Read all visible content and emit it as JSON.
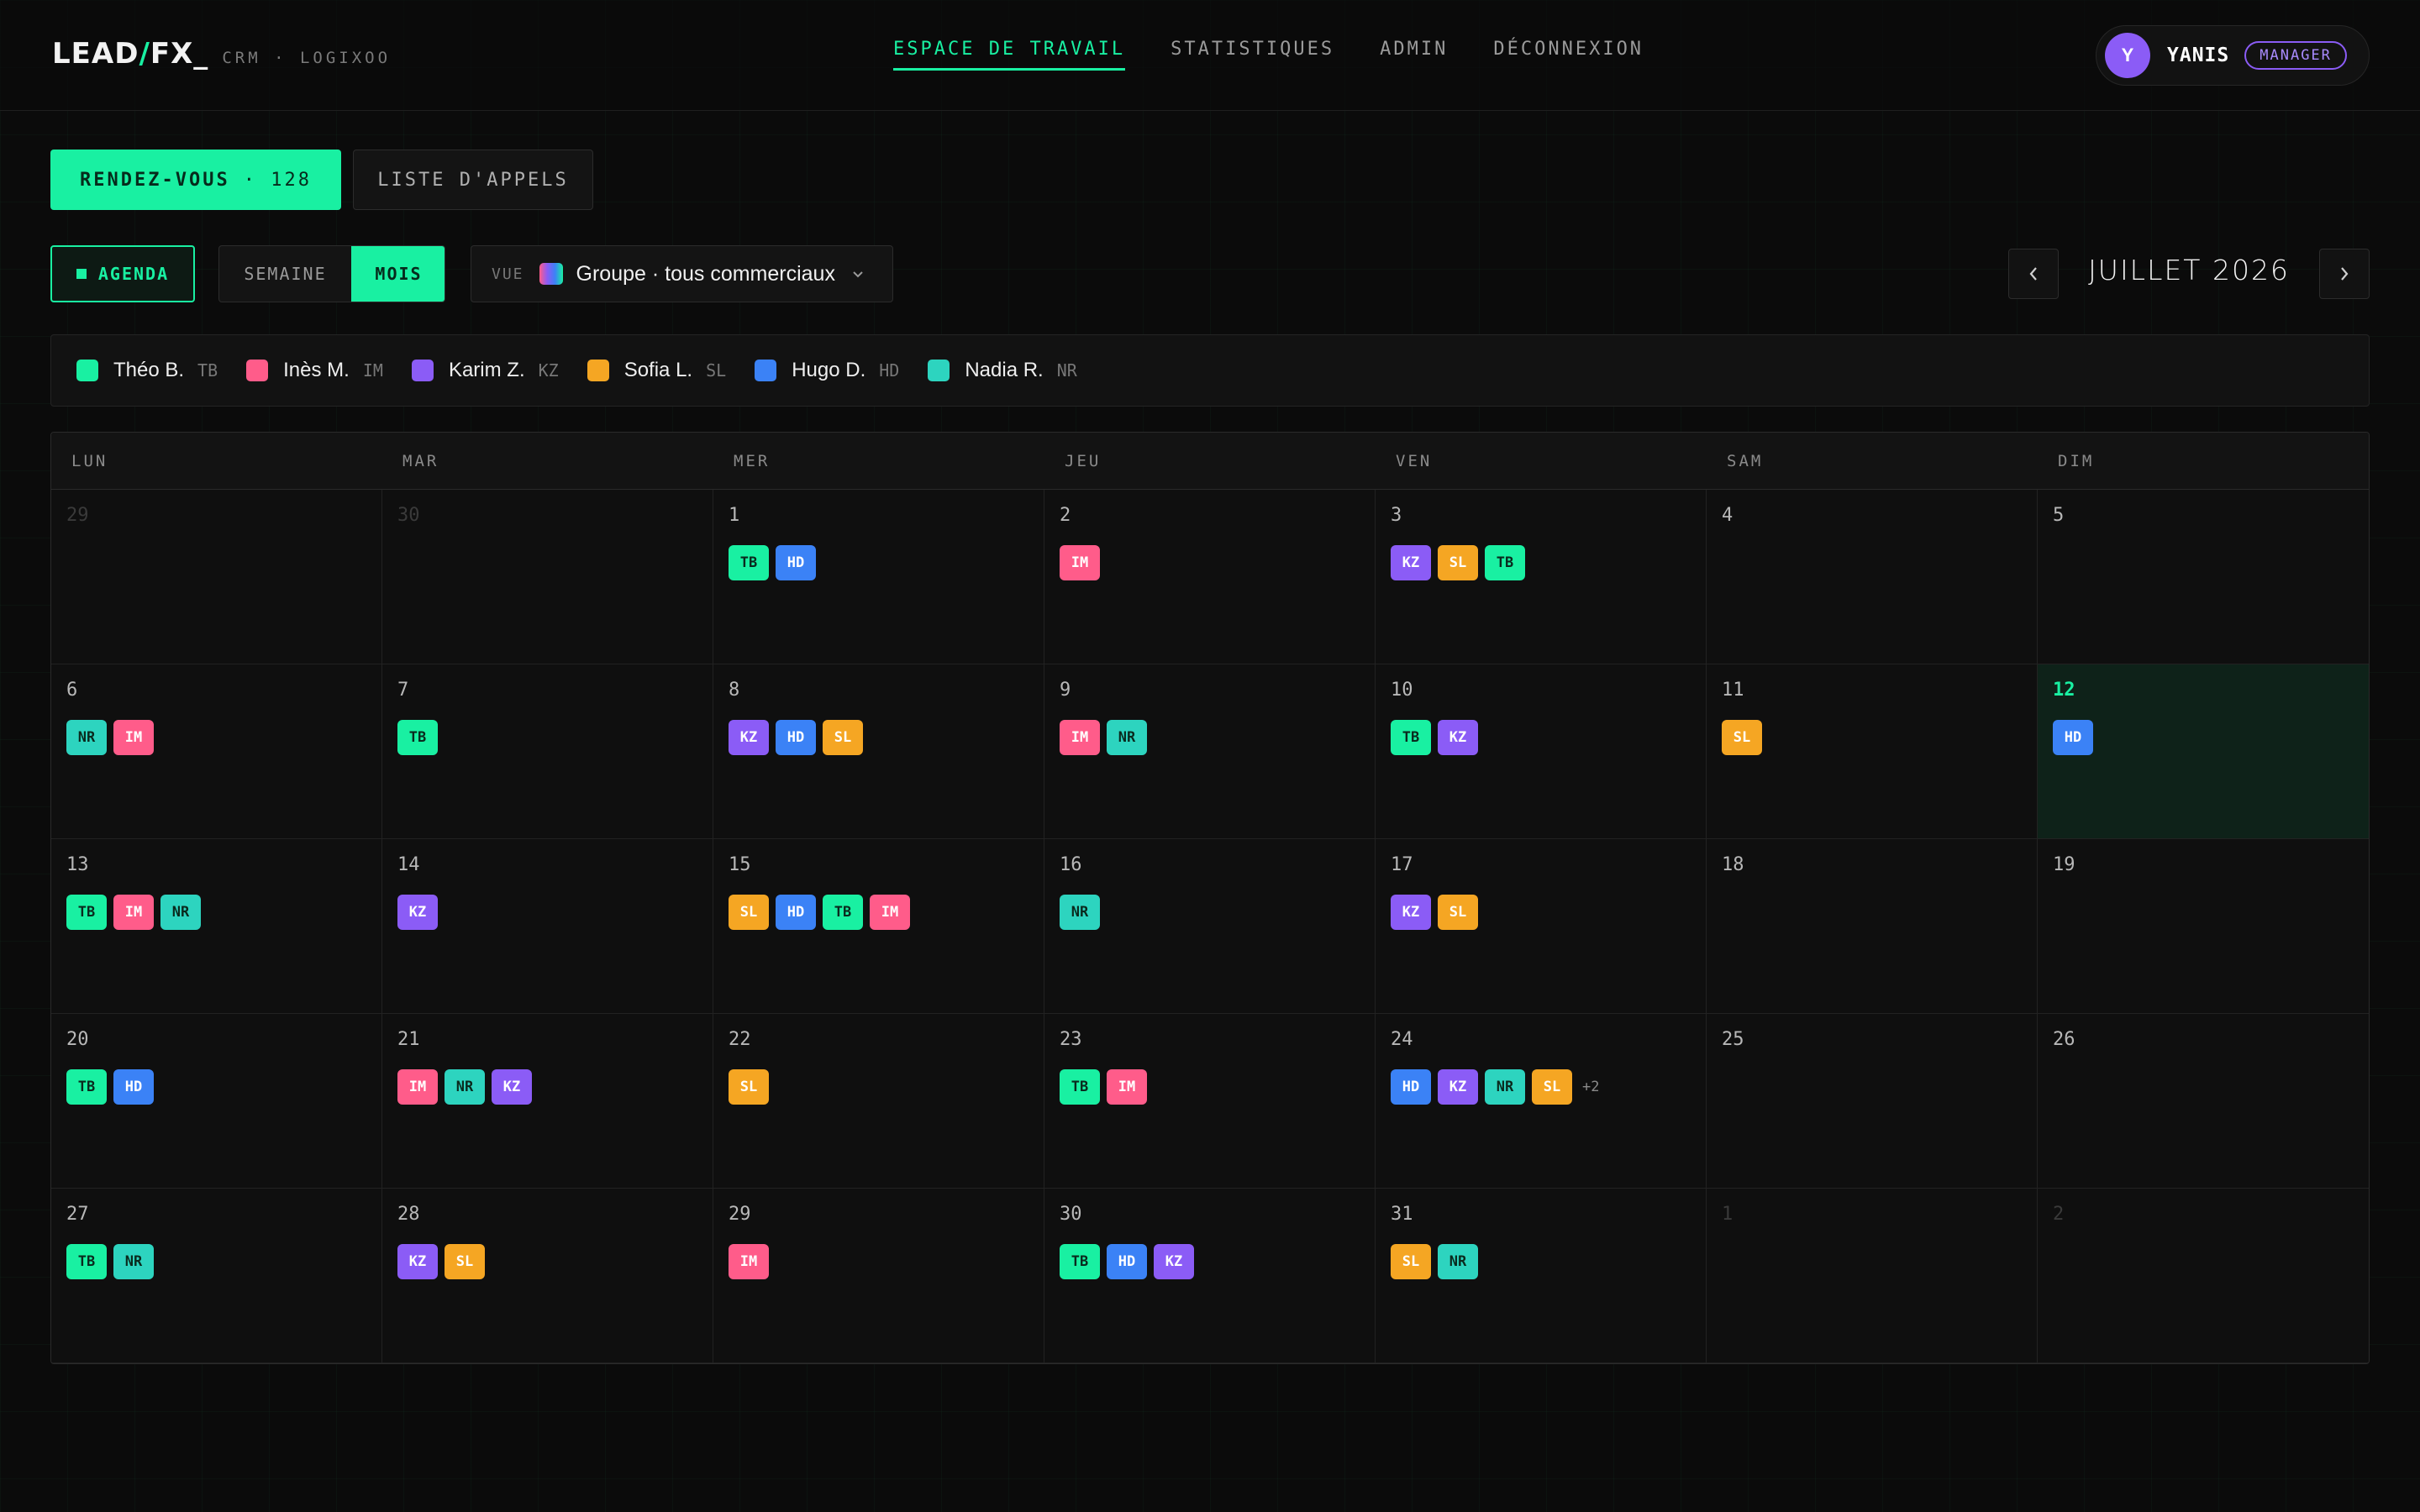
{
  "brand": {
    "logo_left": "LEAD",
    "logo_slash": "/",
    "logo_right": "FX_",
    "subtitle": "CRM · LOGIXOO"
  },
  "nav": [
    {
      "label": "ESPACE DE TRAVAIL",
      "active": true
    },
    {
      "label": "STATISTIQUES",
      "active": false
    },
    {
      "label": "ADMIN",
      "active": false
    },
    {
      "label": "DÉCONNEXION",
      "active": false
    }
  ],
  "user": {
    "initial": "Y",
    "name": "YANIS",
    "role": "MANAGER"
  },
  "tabs": {
    "rdv_label": "RENDEZ-VOUS",
    "rdv_count": "· 128",
    "calls_label": "LISTE D'APPELS"
  },
  "controls": {
    "agenda_label": "AGENDA",
    "week_label": "SEMAINE",
    "month_label": "MOIS",
    "view_label": "VUE",
    "view_value": "Groupe · tous commerciaux",
    "month_title": "JUILLET 2026"
  },
  "legend": [
    {
      "name": "Théo B.",
      "code": "TB",
      "color": "#19f0a2"
    },
    {
      "name": "Inès M.",
      "code": "IM",
      "color": "#ff5c8a"
    },
    {
      "name": "Karim Z.",
      "code": "KZ",
      "color": "#8b5cf6"
    },
    {
      "name": "Sofia L.",
      "code": "SL",
      "color": "#f5a623"
    },
    {
      "name": "Hugo D.",
      "code": "HD",
      "color": "#3b82f6"
    },
    {
      "name": "Nadia R.",
      "code": "NR",
      "color": "#2dd4bf"
    }
  ],
  "weekdays": [
    "LUN",
    "MAR",
    "MER",
    "JEU",
    "VEN",
    "SAM",
    "DIM"
  ],
  "weeks": [
    [
      {
        "day": "29",
        "muted": true,
        "chips": []
      },
      {
        "day": "30",
        "muted": true,
        "chips": []
      },
      {
        "day": "1",
        "chips": [
          "TB",
          "HD"
        ]
      },
      {
        "day": "2",
        "chips": [
          "IM"
        ]
      },
      {
        "day": "3",
        "chips": [
          "KZ",
          "SL",
          "TB"
        ]
      },
      {
        "day": "4",
        "chips": []
      },
      {
        "day": "5",
        "chips": []
      }
    ],
    [
      {
        "day": "6",
        "chips": [
          "NR",
          "IM"
        ]
      },
      {
        "day": "7",
        "chips": [
          "TB"
        ]
      },
      {
        "day": "8",
        "chips": [
          "KZ",
          "HD",
          "SL"
        ]
      },
      {
        "day": "9",
        "chips": [
          "IM",
          "NR"
        ]
      },
      {
        "day": "10",
        "chips": [
          "TB",
          "KZ"
        ]
      },
      {
        "day": "11",
        "chips": [
          "SL"
        ]
      },
      {
        "day": "12",
        "today": true,
        "chips": [
          "HD"
        ]
      }
    ],
    [
      {
        "day": "13",
        "chips": [
          "TB",
          "IM",
          "NR"
        ]
      },
      {
        "day": "14",
        "chips": [
          "KZ"
        ]
      },
      {
        "day": "15",
        "chips": [
          "SL",
          "HD",
          "TB",
          "IM"
        ]
      },
      {
        "day": "16",
        "chips": [
          "NR"
        ]
      },
      {
        "day": "17",
        "chips": [
          "KZ",
          "SL"
        ]
      },
      {
        "day": "18",
        "chips": []
      },
      {
        "day": "19",
        "chips": []
      }
    ],
    [
      {
        "day": "20",
        "chips": [
          "TB",
          "HD"
        ]
      },
      {
        "day": "21",
        "chips": [
          "IM",
          "NR",
          "KZ"
        ]
      },
      {
        "day": "22",
        "chips": [
          "SL"
        ]
      },
      {
        "day": "23",
        "chips": [
          "TB",
          "IM"
        ]
      },
      {
        "day": "24",
        "chips": [
          "HD",
          "KZ",
          "NR",
          "SL"
        ],
        "more": "+2"
      },
      {
        "day": "25",
        "chips": []
      },
      {
        "day": "26",
        "chips": []
      }
    ],
    [
      {
        "day": "27",
        "chips": [
          "TB",
          "NR"
        ]
      },
      {
        "day": "28",
        "chips": [
          "KZ",
          "SL"
        ]
      },
      {
        "day": "29",
        "chips": [
          "IM"
        ]
      },
      {
        "day": "30",
        "chips": [
          "TB",
          "HD",
          "KZ"
        ]
      },
      {
        "day": "31",
        "chips": [
          "SL",
          "NR"
        ]
      },
      {
        "day": "1",
        "muted": true,
        "chips": []
      },
      {
        "day": "2",
        "muted": true,
        "chips": []
      }
    ]
  ]
}
